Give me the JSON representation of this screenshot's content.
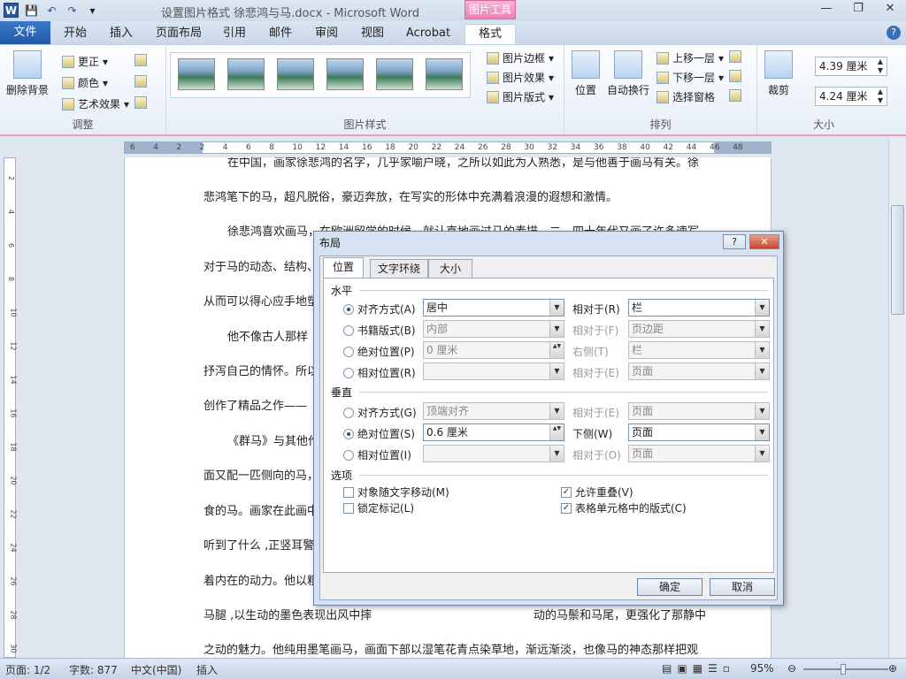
{
  "window": {
    "title": "设置图片格式 徐悲鸿与马.docx - Microsoft Word",
    "context_tab": "图片工具"
  },
  "tabs": [
    "文件",
    "开始",
    "插入",
    "页面布局",
    "引用",
    "邮件",
    "审阅",
    "视图",
    "Acrobat",
    "格式"
  ],
  "ribbon": {
    "adjust": {
      "label": "调整",
      "remove_bg": "删除背景",
      "correct": "更正",
      "color": "颜色",
      "art": "艺术效果"
    },
    "styles": {
      "label": "图片样式",
      "border": "图片边框",
      "effect": "图片效果",
      "layout": "图片版式"
    },
    "arrange": {
      "label": "排列",
      "position": "位置",
      "wrap": "自动换行",
      "forward": "上移一层",
      "backward": "下移一层",
      "pane": "选择窗格"
    },
    "size": {
      "label": "大小",
      "crop": "裁剪",
      "height": "4.39 厘米",
      "width": "4.24 厘米"
    }
  },
  "ruler_ticks": [
    "6",
    "4",
    "2",
    "2",
    "4",
    "6",
    "8",
    "10",
    "12",
    "14",
    "16",
    "18",
    "20",
    "22",
    "24",
    "26",
    "28",
    "30",
    "32",
    "34",
    "36",
    "38",
    "40",
    "42",
    "44",
    "46",
    "48"
  ],
  "left_ruler_ticks": [
    "2",
    "4",
    "6",
    "8",
    "10",
    "12",
    "14",
    "16",
    "18",
    "20",
    "22",
    "24",
    "26",
    "28",
    "30"
  ],
  "page": {
    "lines": [
      "在中国，画家徐悲鸿的名字，几乎家喻户晓，之所以如此为人熟悉，是与他善于画马有关。徐",
      "悲鸿笔下的马，超凡脱俗，豪迈奔放，在写实的形体中充满着浪漫的遐想和激情。",
      "徐悲鸿喜欢画马，在欧洲留学的时候，就认真地画过马的素描，二、四十年代又画了许多速写，",
      "对于马的动态、结构、",
      "从而可以得心应手地塑",
      "他不像古人那样",
      "抒泻自己的情怀。所以",
      "创作了精品之作——",
      "《群马》与其他作",
      "面又配一匹侧向的马，",
      "食的马。画家在此画中",
      "听到了什么 ,正竖耳警",
      "着内在的动力。他以粗",
      "马腿 ,以生动的墨色表现出风中摔",
      "之动的魅力。他纯用墨笔画马，画面下部以湿笔花青点染草地，渐远渐淡，也像马的神态那样把观"
    ],
    "line_tail": "动的马鬃和马尾，更强化了那静中"
  },
  "status": {
    "page": "页面: 1/2",
    "words": "字数: 877",
    "lang": "中文(中国)",
    "mode": "插入",
    "zoom": "95%"
  },
  "dialog": {
    "title": "布局",
    "help": "?",
    "tabs": [
      "位置",
      "文字环绕",
      "大小"
    ],
    "horizontal": {
      "label": "水平",
      "rows": [
        {
          "radio": "对齐方式(A)",
          "value": "居中",
          "rel_label": "相对于(R)",
          "rel_value": "栏",
          "on": true
        },
        {
          "radio": "书籍版式(B)",
          "value": "内部",
          "rel_label": "相对于(F)",
          "rel_value": "页边距",
          "on": false
        },
        {
          "radio": "绝对位置(P)",
          "value": "0 厘米",
          "rel_label": "右侧(T)",
          "rel_value": "栏",
          "on": false
        },
        {
          "radio": "相对位置(R)",
          "value": "",
          "rel_label": "相对于(E)",
          "rel_value": "页面",
          "on": false
        }
      ]
    },
    "vertical": {
      "label": "垂直",
      "rows": [
        {
          "radio": "对齐方式(G)",
          "value": "顶端对齐",
          "rel_label": "相对于(E)",
          "rel_value": "页面",
          "on": false
        },
        {
          "radio": "绝对位置(S)",
          "value": "0.6 厘米",
          "rel_label": "下侧(W)",
          "rel_value": "页面",
          "on": true
        },
        {
          "radio": "相对位置(I)",
          "value": "",
          "rel_label": "相对于(O)",
          "rel_value": "页面",
          "on": false
        }
      ]
    },
    "options": {
      "label": "选项",
      "move": "对象随文字移动(M)",
      "lock": "锁定标记(L)",
      "overlap": "允许重叠(V)",
      "table": "表格单元格中的版式(C)"
    },
    "ok": "确定",
    "cancel": "取消"
  }
}
